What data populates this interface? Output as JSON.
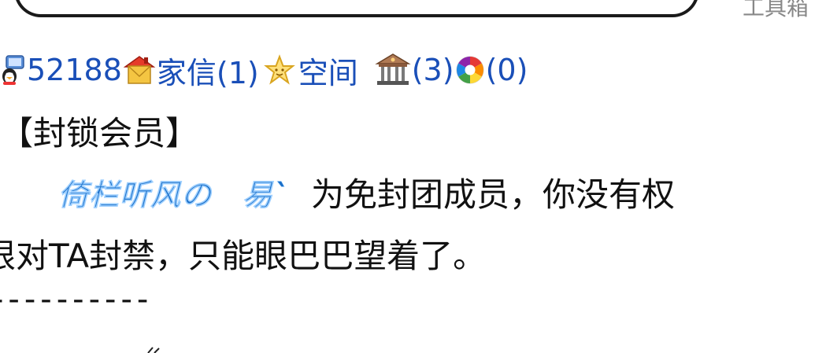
{
  "header": {
    "toolbox_label": "工具箱"
  },
  "stats": {
    "user_id": "52188",
    "mail_label": "家信(1)",
    "space_label": "空间",
    "building_count": "(3)",
    "album_count": "(0)"
  },
  "ban_notice": {
    "title": "【封锁会员】",
    "username": "倚栏听风の　易ˋ",
    "message_part1": "为免封团成员，你没有权",
    "message_part2": "限对TA封禁，只能眼巴巴望着了。",
    "divider": "----------"
  },
  "colors": {
    "link": "#1a4fb8",
    "username": "#1a6fc8"
  },
  "icons": {
    "user_icon": "qq-user-icon",
    "mail_icon": "house-mail-icon",
    "space_icon": "star-space-icon",
    "building_icon": "bank-building-icon",
    "album_icon": "aperture-icon"
  }
}
